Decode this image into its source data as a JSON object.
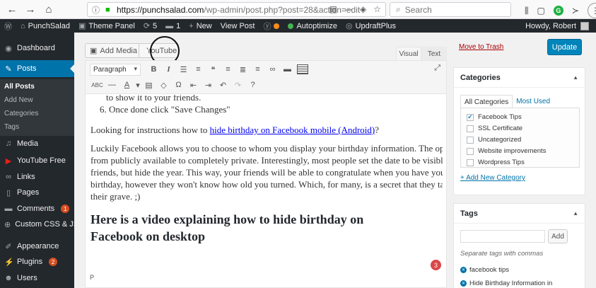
{
  "browser": {
    "url_host": "https://punchsalad.com",
    "url_path": "/wp-admin/post.php?post=28&action=edit",
    "search_placeholder": "Search",
    "ellipsis": "···"
  },
  "adminbar": {
    "site_name": "PunchSalad",
    "theme_panel": "Theme Panel",
    "updates_count": "5",
    "comments_count": "1",
    "new_label": "New",
    "view_post": "View Post",
    "autoptimize": "Autoptimize",
    "updraftplus": "UpdraftPlus",
    "howdy": "Howdy, Robert"
  },
  "sidebar": {
    "dashboard": "Dashboard",
    "posts": "Posts",
    "sub": [
      "All Posts",
      "Add New",
      "Categories",
      "Tags"
    ],
    "media": "Media",
    "youtube_free": "YouTube Free",
    "links": "Links",
    "pages": "Pages",
    "comments": "Comments",
    "comments_badge": "1",
    "custom_css": "Custom CSS & JS",
    "appearance": "Appearance",
    "plugins": "Plugins",
    "plugins_badge": "2",
    "users": "Users"
  },
  "editor": {
    "add_media": "Add Media",
    "youtube": "YouTube",
    "tab_visual": "Visual",
    "tab_text": "Text",
    "format": "Paragraph",
    "line_partial": "to show it to your friends.",
    "step6": "6. Once done click \"Save Changes\"",
    "p1_pre": "Looking for instructions how to ",
    "p1_link": "hide birthday on Facebook mobile (Android)",
    "p1_post": "?",
    "p2": [
      "Luckily Facebook allows you to choose to whom you display your birthday information. The options vary",
      "from publicly available to completely private. Interestingly, most people set the date to be visible to their",
      "friends, but hide the year. This way, your friends will be able to congratulate when you have your",
      "birthday, however they won't know how old you turned. Which, for many, is a secret that they take to",
      "their grave. ;)"
    ],
    "heading": [
      "Here is a video explaining how to hide birthday on",
      "Facebook on desktop"
    ],
    "path_indicator": "P",
    "notif_count": "3"
  },
  "publish": {
    "trash": "Move to Trash",
    "update": "Update"
  },
  "categories": {
    "title": "Categories",
    "tab_all": "All Categories",
    "tab_used": "Most Used",
    "items": [
      {
        "label": "Facebook Tips",
        "checked": true
      },
      {
        "label": "SSL Certificate",
        "checked": false
      },
      {
        "label": "Uncategorized",
        "checked": false
      },
      {
        "label": "Website improvements",
        "checked": false
      },
      {
        "label": "Wordpress Tips",
        "checked": false
      }
    ],
    "add_new": "+ Add New Category"
  },
  "tags": {
    "title": "Tags",
    "add_btn": "Add",
    "hint": "Separate tags with commas",
    "items": [
      "facebook tips",
      "Hide Birthday Information in"
    ]
  }
}
